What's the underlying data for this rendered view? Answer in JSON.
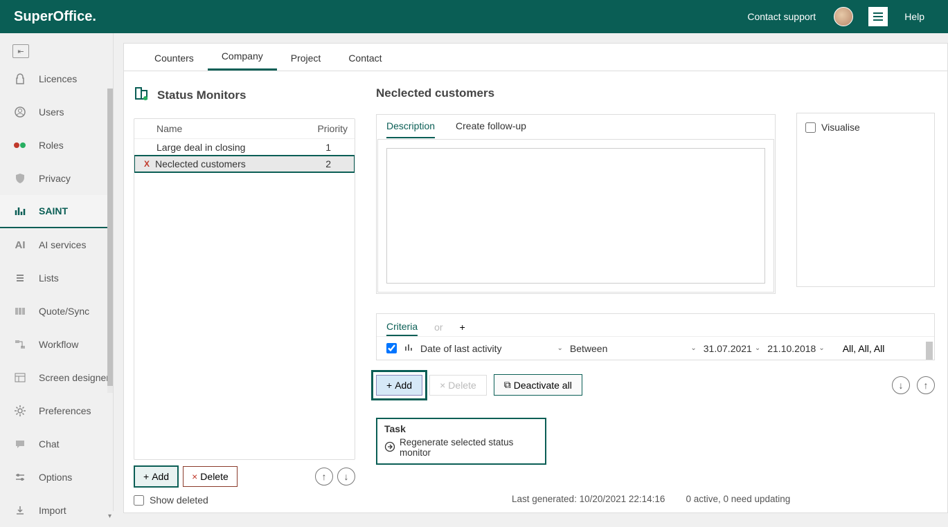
{
  "topbar": {
    "brand": "SuperOffice.",
    "contact_support": "Contact support",
    "help": "Help"
  },
  "nav": {
    "items": [
      {
        "label": "Licences"
      },
      {
        "label": "Users"
      },
      {
        "label": "Roles"
      },
      {
        "label": "Privacy"
      },
      {
        "label": "SAINT"
      },
      {
        "label": "AI services"
      },
      {
        "label": "Lists"
      },
      {
        "label": "Quote/Sync"
      },
      {
        "label": "Workflow"
      },
      {
        "label": "Screen designer"
      },
      {
        "label": "Preferences"
      },
      {
        "label": "Chat"
      },
      {
        "label": "Options"
      },
      {
        "label": "Import"
      }
    ]
  },
  "main_tabs": {
    "counters": "Counters",
    "company": "Company",
    "project": "Project",
    "contact": "Contact"
  },
  "status_monitors": {
    "title": "Status Monitors",
    "name_header": "Name",
    "priority_header": "Priority",
    "rows": [
      {
        "name": "Large deal in closing",
        "priority": "1"
      },
      {
        "name": "Neclected customers",
        "priority": "2"
      }
    ],
    "add": "Add",
    "delete": "Delete",
    "show_deleted": "Show deleted"
  },
  "detail": {
    "title": "Neclected customers",
    "tab_description": "Description",
    "tab_followup": "Create follow-up",
    "visualise": "Visualise"
  },
  "criteria": {
    "tab_label": "Criteria",
    "or_label": "or",
    "plus_label": "+",
    "field": "Date of last activity",
    "operator": "Between",
    "date1": "31.07.2021",
    "date2": "21.10.2018",
    "summary": "All, All, All",
    "add": "Add",
    "delete": "Delete",
    "deactivate": "Deactivate all"
  },
  "task": {
    "label": "Task",
    "regenerate": "Regenerate selected status monitor"
  },
  "footer": {
    "last_generated": "Last generated: 10/20/2021 22:14:16",
    "status": "0 active, 0 need updating"
  }
}
